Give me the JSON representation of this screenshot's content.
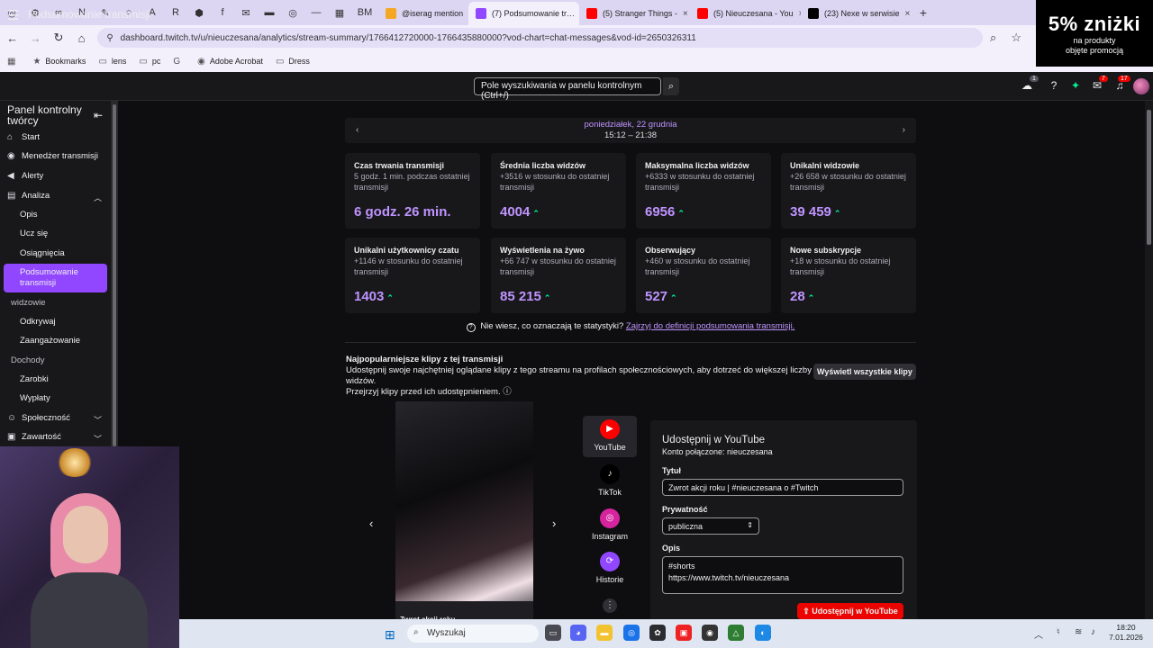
{
  "browser": {
    "pinned_tabs": [
      "◎",
      "⚙",
      "∞",
      "N",
      "✎",
      "○",
      "A",
      "R",
      "⬢",
      "f",
      "✉",
      "▬",
      "◎",
      "—",
      "▦",
      "BM"
    ],
    "tabs": [
      {
        "title": "@iserag mention",
        "active": false,
        "fav_color": "#f5a623"
      },
      {
        "title": "(7) Podsumowanie tr…",
        "active": true,
        "fav_color": "#9147ff"
      },
      {
        "title": "(5) Stranger Things -",
        "active": false,
        "fav_color": "#ff0000"
      },
      {
        "title": "(5) Nieuczesana - You",
        "active": false,
        "fav_color": "#ff0000"
      },
      {
        "title": "(23) Nexe w serwisie",
        "active": false,
        "fav_color": "#000000"
      }
    ],
    "new_tab": "+",
    "close_glyph": "×",
    "url": "dashboard.twitch.tv/u/nieuczesana/analytics/stream-summary/1766412720000-1766435880000?vod-chart=chat-messages&vod-id=2650326311",
    "bookmarks": [
      {
        "icon": "★",
        "label": "Bookmarks"
      },
      {
        "icon": "▭",
        "label": "lens"
      },
      {
        "icon": "▭",
        "label": "pc"
      },
      {
        "icon": "G",
        "label": ""
      },
      {
        "icon": "◉",
        "label": "Adobe Acrobat"
      },
      {
        "icon": "▭",
        "label": "Dress"
      }
    ]
  },
  "ad": {
    "big": "5% zniżki",
    "line1": "na produkty",
    "line2": "objęte promocją"
  },
  "header": {
    "title": "Podsumowanie transmisji",
    "search_placeholder": "Pole wyszukiwania w panelu kontrolnym (Ctrl+/)",
    "badge_1": "1",
    "badge_7": "7",
    "badge_17": "17"
  },
  "sidebar": {
    "title": "Panel kontrolny twórcy",
    "items": {
      "start": "Start",
      "stream_manager": "Menedżer transmisji",
      "alerts": "Alerty",
      "analytics": "Analiza",
      "overview": "Opis",
      "learn": "Ucz się",
      "achievements": "Osiągnięcia",
      "summary": "Podsumowanie transmisji",
      "viewers_section": "widzowie",
      "discover": "Odkrywaj",
      "engagement": "Zaangażowanie",
      "revenue_section": "Dochody",
      "earn": "Zarobki",
      "payouts": "Wypłaty",
      "community": "Społeczność",
      "content": "Zawartość"
    }
  },
  "date_nav": {
    "day": "poniedziałek, 22 grudnia",
    "time": "15:12 – 21:38"
  },
  "stats": [
    {
      "title": "Czas trwania transmisji",
      "sub": "5 godz. 1 min. podczas ostatniej transmisji",
      "value": "6 godz. 26 min.",
      "up": ""
    },
    {
      "title": "Średnia liczba widzów",
      "sub": "+3516 w stosunku do ostatniej transmisji",
      "value": "4004",
      "up": "⌃"
    },
    {
      "title": "Maksymalna liczba widzów",
      "sub": "+6333 w stosunku do ostatniej transmisji",
      "value": "6956",
      "up": "⌃"
    },
    {
      "title": "Unikalni widzowie",
      "sub": "+26 658 w stosunku do ostatniej transmisji",
      "value": "39 459",
      "up": "⌃"
    },
    {
      "title": "Unikalni użytkownicy czatu",
      "sub": "+1146 w stosunku do ostatniej transmisji",
      "value": "1403",
      "up": "⌃"
    },
    {
      "title": "Wyświetlenia na żywo",
      "sub": "+66 747 w stosunku do ostatniej transmisji",
      "value": "85 215",
      "up": "⌃"
    },
    {
      "title": "Obserwujący",
      "sub": "+460 w stosunku do ostatniej transmisji",
      "value": "527",
      "up": "⌃"
    },
    {
      "title": "Nowe subskrypcje",
      "sub": "+18 w stosunku do ostatniej transmisji",
      "value": "28",
      "up": "⌃"
    }
  ],
  "help": {
    "text": "Nie wiesz, co oznaczają te statystyki?",
    "link": "Zajrzyj do definicji podsumowania transmisji."
  },
  "clips": {
    "title": "Najpopularniejsze klipy z tej transmisji",
    "desc_1": "Udostępnij swoje najchętniej oglądane klipy z tego streamu na profilach społecznościowych, aby dotrzeć do większej liczby widzów.",
    "desc_2": "Przejrzyj klipy przed ich udostępnieniem.",
    "view_all": "Wyświetl wszystkie klipy",
    "clip_caption": "Zwrot akcji roku"
  },
  "share_targets": [
    {
      "label": "YouTube",
      "color": "#ff0000",
      "glyph": "▶"
    },
    {
      "label": "TikTok",
      "color": "#000000",
      "glyph": "♪"
    },
    {
      "label": "Instagram",
      "color": "#d6249f",
      "glyph": "◎"
    },
    {
      "label": "Historie",
      "color": "#9147ff",
      "glyph": "⟳"
    }
  ],
  "form": {
    "heading": "Udostępnij w YouTube",
    "account": "Konto połączone: nieuczesana",
    "title_label": "Tytuł",
    "title_value": "Zwrot akcji roku | #nieuczesana o #Twitch",
    "privacy_label": "Prywatność",
    "privacy_value": "publiczna",
    "desc_label": "Opis",
    "desc_line1": "#shorts",
    "desc_line2": "https://www.twitch.tv/nieuczesana",
    "submit": "Udostępnij w YouTube"
  },
  "taskbar": {
    "search": "Wyszukaj",
    "time": "18:20",
    "date": "7.01.2026"
  }
}
